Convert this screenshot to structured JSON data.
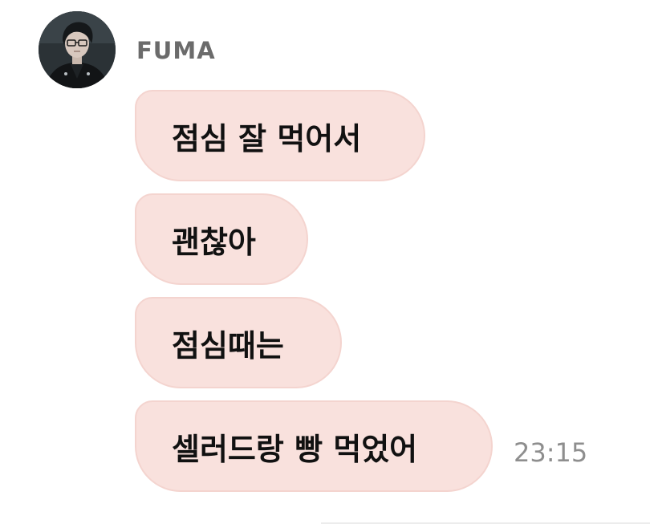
{
  "sender": {
    "name": "FUMA",
    "avatar_icon": "profile-photo"
  },
  "messages": [
    {
      "text": "점심 잘 먹어서"
    },
    {
      "text": "괜찮아"
    },
    {
      "text": "점심때는"
    },
    {
      "text": "셀러드랑 빵 먹었어"
    }
  ],
  "timestamp": "23:15",
  "colors": {
    "bubble_bg": "#f9e1dd",
    "bubble_border": "#f4d4cf",
    "name_text": "#6b6b6b",
    "timestamp_text": "#8e8e8e"
  }
}
